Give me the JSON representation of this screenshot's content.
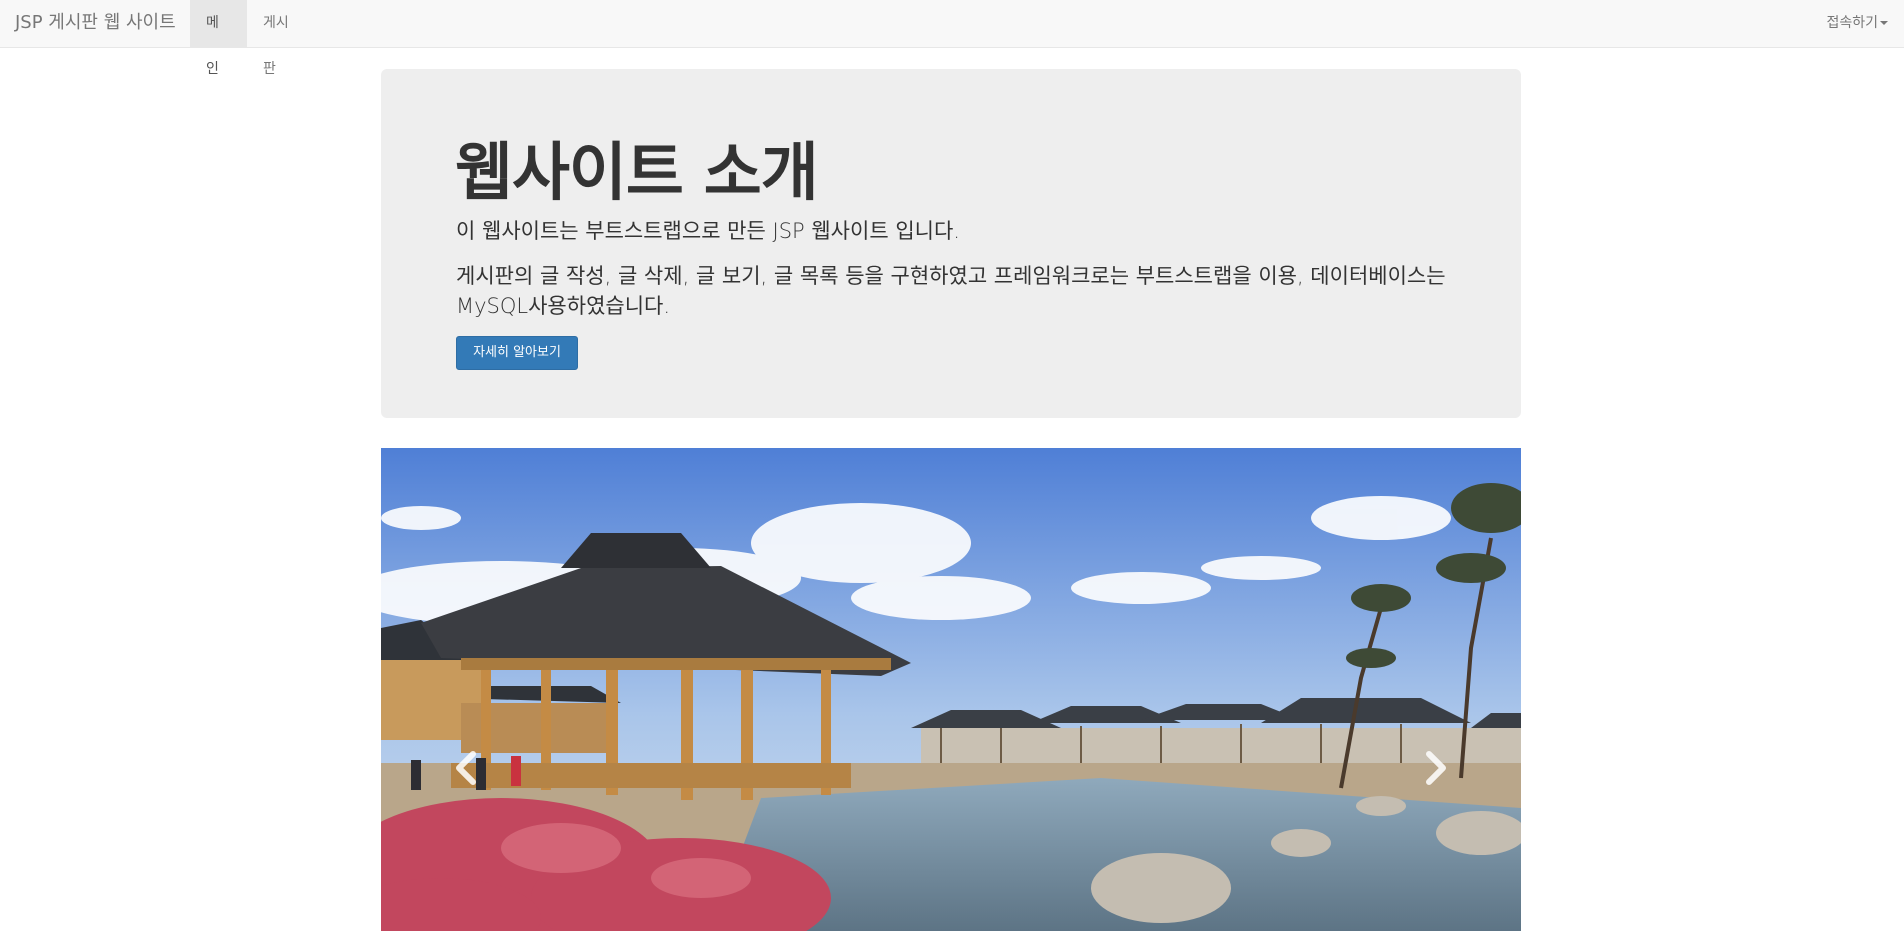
{
  "navbar": {
    "brand": "JSP 게시판 웹 사이트",
    "items": [
      {
        "label": "메인",
        "active": true
      },
      {
        "label": "게시판",
        "active": false
      }
    ],
    "dropdown_label": "접속하기"
  },
  "jumbotron": {
    "title": "웹사이트 소개",
    "paragraph1": "이 웹사이트는 부트스트랩으로 만든 JSP 웹사이트 입니다.",
    "paragraph2": "게시판의 글 작성, 글 삭제, 글 보기, 글 목록 등을 구현하였고 프레임워크로는 부트스트랩을 이용, 데이터베이스는 MySQL사용하였습니다.",
    "button_label": "자세히 알아보기"
  },
  "carousel": {
    "left_icon": "chevron-left-icon",
    "right_icon": "chevron-right-icon"
  },
  "colors": {
    "primary": "#337ab7",
    "navbar_bg": "#f8f8f8",
    "jumbotron_bg": "#eeeeee"
  }
}
